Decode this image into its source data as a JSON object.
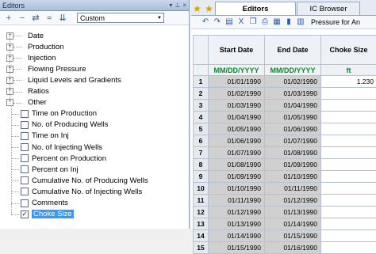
{
  "left_panel": {
    "title": "Editors",
    "title_icons": [
      "dropdown-icon",
      "pin-icon",
      "close-icon"
    ],
    "toolbar": {
      "icons": [
        "add-icon",
        "remove-icon",
        "move-icon",
        "collapse-icon",
        "expand-icon"
      ],
      "preset_value": "Custom"
    },
    "tree": {
      "groups": [
        "Date",
        "Production",
        "Injection",
        "Flowing Pressure",
        "Liquid Levels and Gradients",
        "Ratios",
        "Other"
      ],
      "other_children": [
        {
          "label": "Time on Production",
          "checked": false
        },
        {
          "label": "No. of Producing Wells",
          "checked": false
        },
        {
          "label": "Time on Inj",
          "checked": false
        },
        {
          "label": "No. of Injecting Wells",
          "checked": false
        },
        {
          "label": "Percent on Production",
          "checked": false
        },
        {
          "label": "Percent on Inj",
          "checked": false
        },
        {
          "label": "Cumulative No. of Producing Wells",
          "checked": false
        },
        {
          "label": "Cumulative No. of Injecting Wells",
          "checked": false
        },
        {
          "label": "Comments",
          "checked": false
        },
        {
          "label": "Choke Size",
          "checked": true
        }
      ]
    }
  },
  "right_panel": {
    "tabs": [
      {
        "label": "Editors",
        "active": true
      },
      {
        "label": "IC Browser",
        "active": false
      }
    ],
    "toolbar_label": "Pressure for An",
    "grid": {
      "columns": [
        "Start Date",
        "End Date",
        "Choke Size"
      ],
      "units": [
        "MM/DD/YYYY",
        "MM/DD/YYYY",
        "ft"
      ],
      "rows": [
        {
          "n": "1",
          "start": "01/01/1990",
          "end": "01/02/1990",
          "choke": "1.230"
        },
        {
          "n": "2",
          "start": "01/02/1990",
          "end": "01/03/1990",
          "choke": ""
        },
        {
          "n": "3",
          "start": "01/03/1990",
          "end": "01/04/1990",
          "choke": ""
        },
        {
          "n": "4",
          "start": "01/04/1990",
          "end": "01/05/1990",
          "choke": ""
        },
        {
          "n": "5",
          "start": "01/05/1990",
          "end": "01/06/1990",
          "choke": ""
        },
        {
          "n": "6",
          "start": "01/06/1990",
          "end": "01/07/1990",
          "choke": ""
        },
        {
          "n": "7",
          "start": "01/07/1990",
          "end": "01/08/1990",
          "choke": ""
        },
        {
          "n": "8",
          "start": "01/08/1990",
          "end": "01/09/1990",
          "choke": ""
        },
        {
          "n": "9",
          "start": "01/09/1990",
          "end": "01/10/1990",
          "choke": ""
        },
        {
          "n": "10",
          "start": "01/10/1990",
          "end": "01/11/1990",
          "choke": ""
        },
        {
          "n": "11",
          "start": "01/11/1990",
          "end": "01/12/1990",
          "choke": ""
        },
        {
          "n": "12",
          "start": "01/12/1990",
          "end": "01/13/1990",
          "choke": ""
        },
        {
          "n": "13",
          "start": "01/13/1990",
          "end": "01/14/1990",
          "choke": ""
        },
        {
          "n": "14",
          "start": "01/14/1990",
          "end": "01/15/1990",
          "choke": ""
        },
        {
          "n": "15",
          "start": "01/15/1990",
          "end": "01/16/1990",
          "choke": ""
        }
      ]
    }
  }
}
